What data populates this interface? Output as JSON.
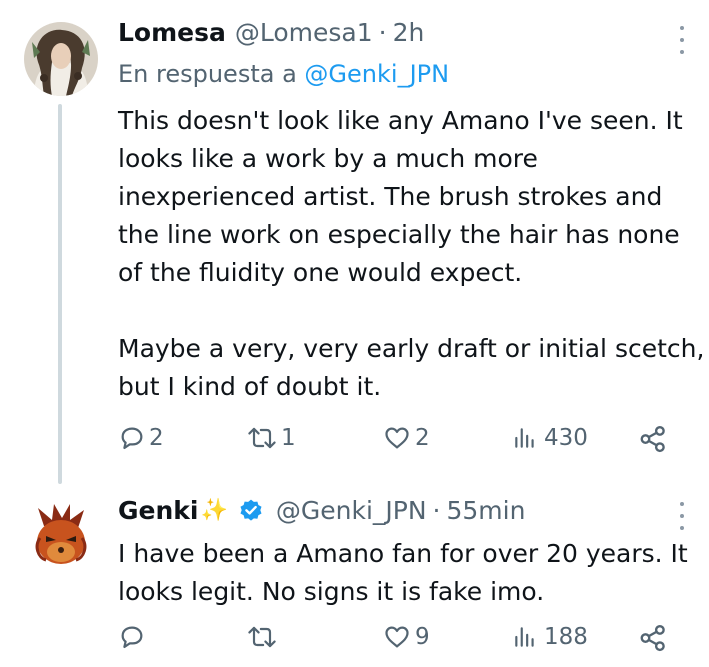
{
  "colors": {
    "text": "#0f1419",
    "muted": "#536471",
    "link": "#1d9bf0",
    "thread_line": "#cfd9de",
    "verified": "#1d9bf0"
  },
  "tweets": [
    {
      "display_name": "Lomesa",
      "handle": "@Lomesa1",
      "separator": "·",
      "time": "2h",
      "reply_prefix": "En respuesta a",
      "reply_mention": "@Genki_JPN",
      "body_lines": [
        "This doesn't look like any Amano I've seen. It",
        "looks like a work by a much more",
        "inexperienced artist. The brush strokes and",
        "the line work on especially the hair has none",
        "of the fluidity one would expect.",
        "Maybe a very, very early draft or initial scetch,",
        "but I kind of doubt it."
      ],
      "replies": "2",
      "reposts": "1",
      "likes": "2",
      "views": "430",
      "avatar_icon": "profile-avatar",
      "icons": [
        "reply-icon",
        "repost-icon",
        "like-icon",
        "views-icon",
        "share-icon",
        "more-icon"
      ]
    },
    {
      "display_name": "Genki",
      "name_emoji": "✨",
      "handle": "@Genki_JPN",
      "separator": "·",
      "time": "55min",
      "body_lines": [
        "I have been a Amano fan for over 20 years. It",
        "looks legit. No signs it is fake imo."
      ],
      "replies": "",
      "reposts": "",
      "likes": "9",
      "views": "188",
      "avatar_icon": "profile-avatar",
      "icons": [
        "verified-badge-icon",
        "reply-icon",
        "repost-icon",
        "like-icon",
        "views-icon",
        "share-icon",
        "more-icon"
      ]
    }
  ]
}
